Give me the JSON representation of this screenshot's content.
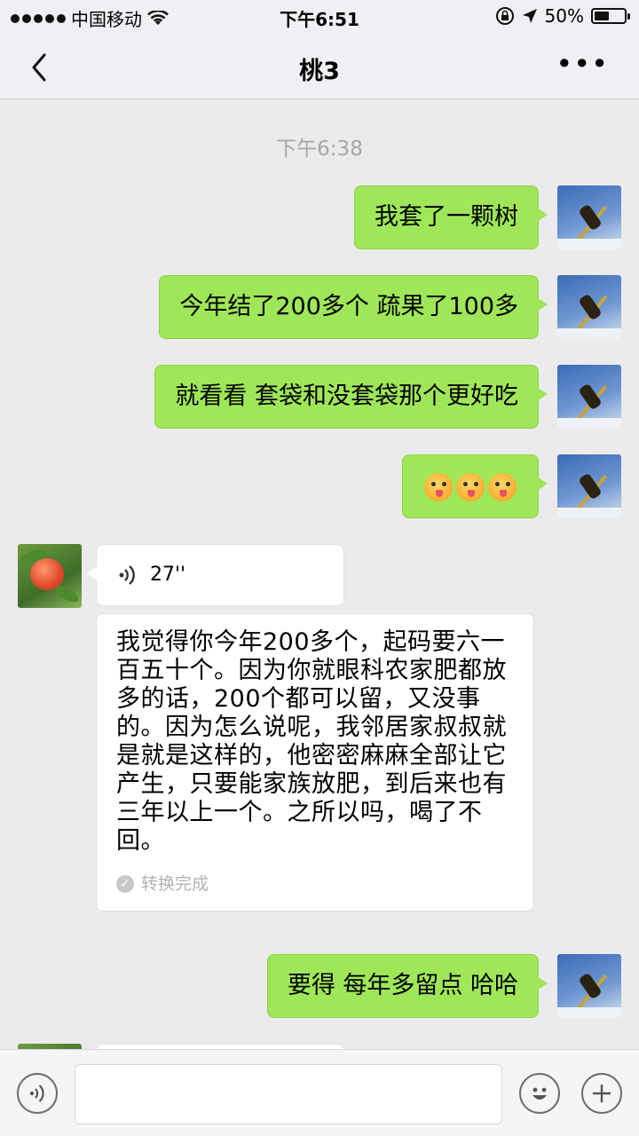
{
  "status_bar": {
    "carrier": "中国移动",
    "time": "下午6:51",
    "battery_text": "50%",
    "battery_level": 0.5
  },
  "nav": {
    "title": "桃3",
    "more": "•••"
  },
  "chat": {
    "timestamp": "下午6:38",
    "messages_me_1": "我套了一颗树",
    "messages_me_2": "今年结了200多个 疏果了100多",
    "messages_me_3": "就看看 套袋和没套袋那个更好吃",
    "messages_me_4_emoji": [
      "wink-tongue-emoji",
      "wink-tongue-emoji",
      "wink-tongue-emoji"
    ],
    "voice_duration": "27''",
    "transcript": "我觉得你今年200多个，起码要六一百五十个。因为你就眼科农家肥都放多的话，200个都可以留，又没事的。因为怎么说呢，我邻居家叔叔就是就是这样的，他密密麻麻全部让它产生，只要能家族放肥，到后来也有三年以上一个。之所以吗，喝了不回。",
    "transcript_status": "转换完成",
    "messages_me_5": "要得 每年多留点 哈哈"
  },
  "input": {
    "value": "",
    "placeholder": ""
  },
  "icons": {
    "back": "chevron-left-icon",
    "more": "more-dots-icon",
    "voice": "voice-wave-icon",
    "emoji": "smiley-icon",
    "plus": "plus-icon",
    "wifi": "wifi-icon",
    "lock_rotation": "rotation-lock-icon",
    "location": "location-arrow-icon"
  },
  "colors": {
    "my_bubble": "#9fe658",
    "other_bubble": "#ffffff",
    "chat_bg": "#ebebeb"
  }
}
